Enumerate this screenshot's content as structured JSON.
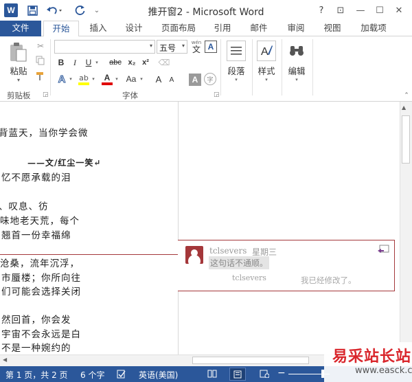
{
  "window": {
    "title": "推开窗2 - Microsoft Word",
    "help": "?",
    "controls": [
      "⊡",
      "—",
      "☐",
      "✕"
    ]
  },
  "quick_access": {
    "logo": "W",
    "save_icon": "save-icon",
    "undo_icon": "undo-icon",
    "redo_icon": "redo-icon"
  },
  "tabs": [
    "文件",
    "开始",
    "插入",
    "设计",
    "页面布局",
    "引用",
    "邮件",
    "审阅",
    "视图",
    "加载项"
  ],
  "ribbon": {
    "clipboard": {
      "paste": "粘贴",
      "group": "剪贴板"
    },
    "font": {
      "name": "",
      "size": "五号",
      "wen": "wén",
      "wen_char": "文",
      "frame_a": "A",
      "bold": "B",
      "italic": "I",
      "underline": "U",
      "strike": "abc",
      "sub": "x₂",
      "sup": "x²",
      "text_effects": "A",
      "font_color": "A",
      "change_case": "Aa",
      "grow": "A",
      "shrink": "A",
      "shade_a": "A",
      "circle_char": "字",
      "group": "字体"
    },
    "paragraph": {
      "label": "段落"
    },
    "styles": {
      "label": "样式"
    },
    "editing": {
      "label": "编辑"
    }
  },
  "document": {
    "lines": [
      "背蓝天，当你学会微",
      "——文/红尘一笑↵",
      "忆不愿承载的泪",
      "、叹息、彷",
      "味地老天荒，每个",
      "翘首一份幸福绵",
      "沧桑，流年沉浮，",
      "市蜃楼；你所向往",
      "们可能会选择关闭",
      "然回首，你会发",
      "宇宙不会永远是白",
      "不是一种婉约的"
    ]
  },
  "comment": {
    "author": "tclsevers",
    "time": "星期三",
    "text": "这句话不通顺。",
    "reply_author": "tclsevers",
    "reply_text": "我已经修改了。"
  },
  "status_bar": {
    "page": "第 1 页，共 2 页",
    "words": "6 个字",
    "language": "英语(美国)"
  },
  "watermark": {
    "text": "易采站长站",
    "url": "www.easck.com"
  },
  "colors": {
    "accent": "#2b579a",
    "comment": "#a4373a"
  }
}
